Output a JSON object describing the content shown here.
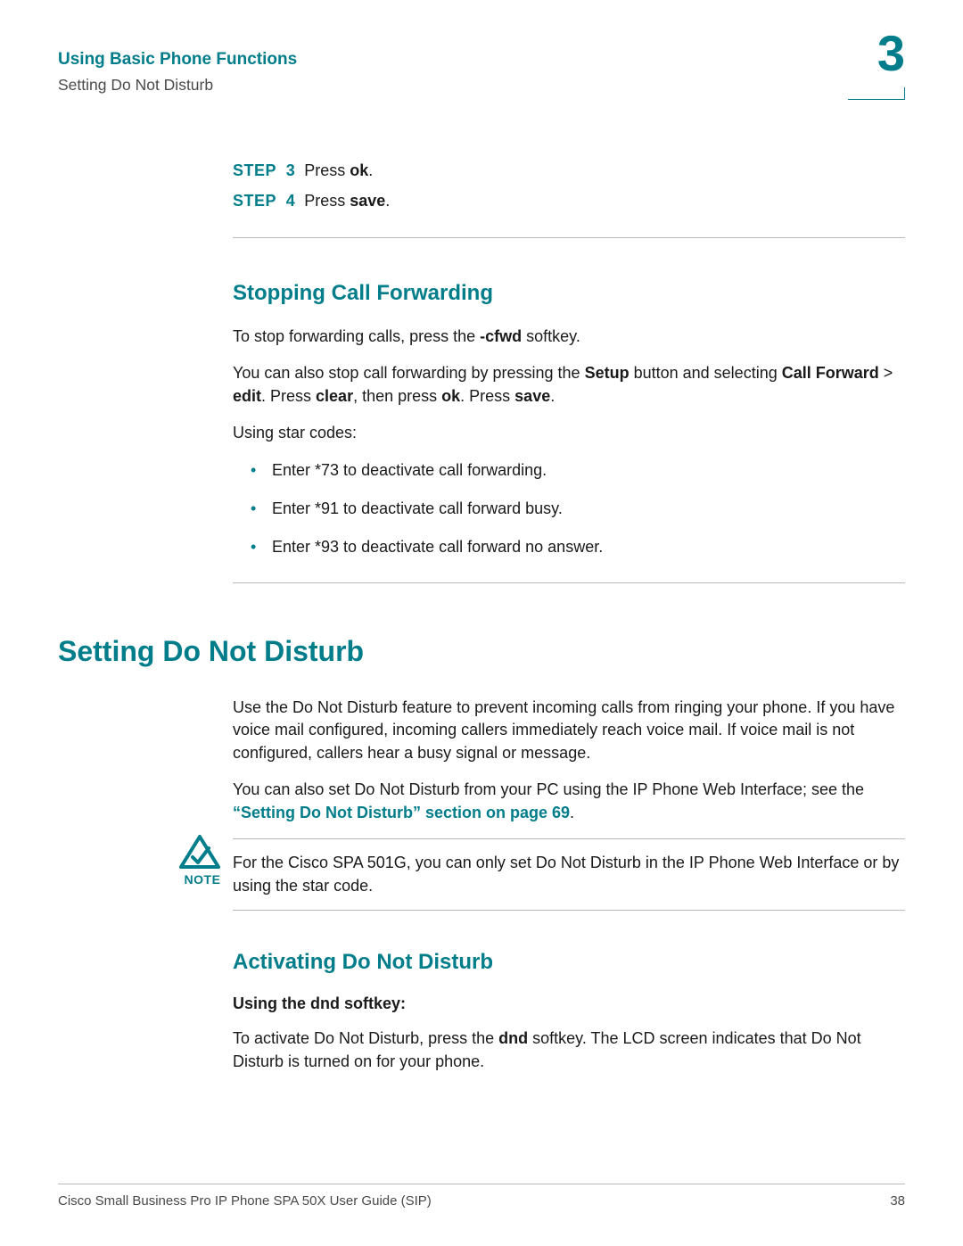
{
  "header": {
    "title": "Using Basic Phone Functions",
    "subtitle": "Setting Do Not Disturb",
    "chapter": "3"
  },
  "steps": [
    {
      "label": "STEP  3",
      "pre": "Press ",
      "bold": "ok",
      "post": "."
    },
    {
      "label": "STEP  4",
      "pre": "Press ",
      "bold": "save",
      "post": "."
    }
  ],
  "sec1": {
    "heading": "Stopping Call Forwarding",
    "p1": {
      "pre": "To stop forwarding calls, press the ",
      "b1": "-cfwd",
      "post": " softkey."
    },
    "p2": {
      "t1": "You can also stop call forwarding by pressing the ",
      "b1": "Setup",
      "t2": " button and selecting ",
      "b2": "Call Forward",
      "t3": " > ",
      "b3": "edit",
      "t4": ". Press ",
      "b4": "clear",
      "t5": ", then press ",
      "b5": "ok",
      "t6": ". Press ",
      "b6": "save",
      "t7": "."
    },
    "p3": "Using star codes:",
    "bullets": [
      "Enter *73 to deactivate call forwarding.",
      "Enter *91 to deactivate call forward busy.",
      "Enter *93 to deactivate call forward no answer."
    ]
  },
  "sec2": {
    "heading": "Setting Do Not Disturb",
    "p1": "Use the Do Not Disturb feature to prevent incoming calls from ringing your phone. If you have voice mail configured, incoming callers immediately reach voice mail. If voice mail is not configured, callers hear a busy signal or message.",
    "p2": {
      "t1": "You can also set Do Not Disturb from your PC using the IP Phone Web Interface; see the ",
      "link": "“Setting Do Not Disturb” section on page 69",
      "t2": "."
    },
    "note_label": "NOTE",
    "note": "For the Cisco SPA 501G, you can only set Do Not Disturb in the IP Phone Web Interface or by using the star code."
  },
  "sec3": {
    "heading": "Activating Do Not Disturb",
    "sub": "Using the dnd softkey:",
    "p1": {
      "t1": "To activate Do Not Disturb, press the ",
      "b1": "dnd",
      "t2": " softkey. The LCD screen indicates that Do Not Disturb is turned on for your phone."
    }
  },
  "footer": {
    "left": "Cisco Small Business Pro IP Phone SPA 50X User Guide (SIP)",
    "right": "38"
  }
}
